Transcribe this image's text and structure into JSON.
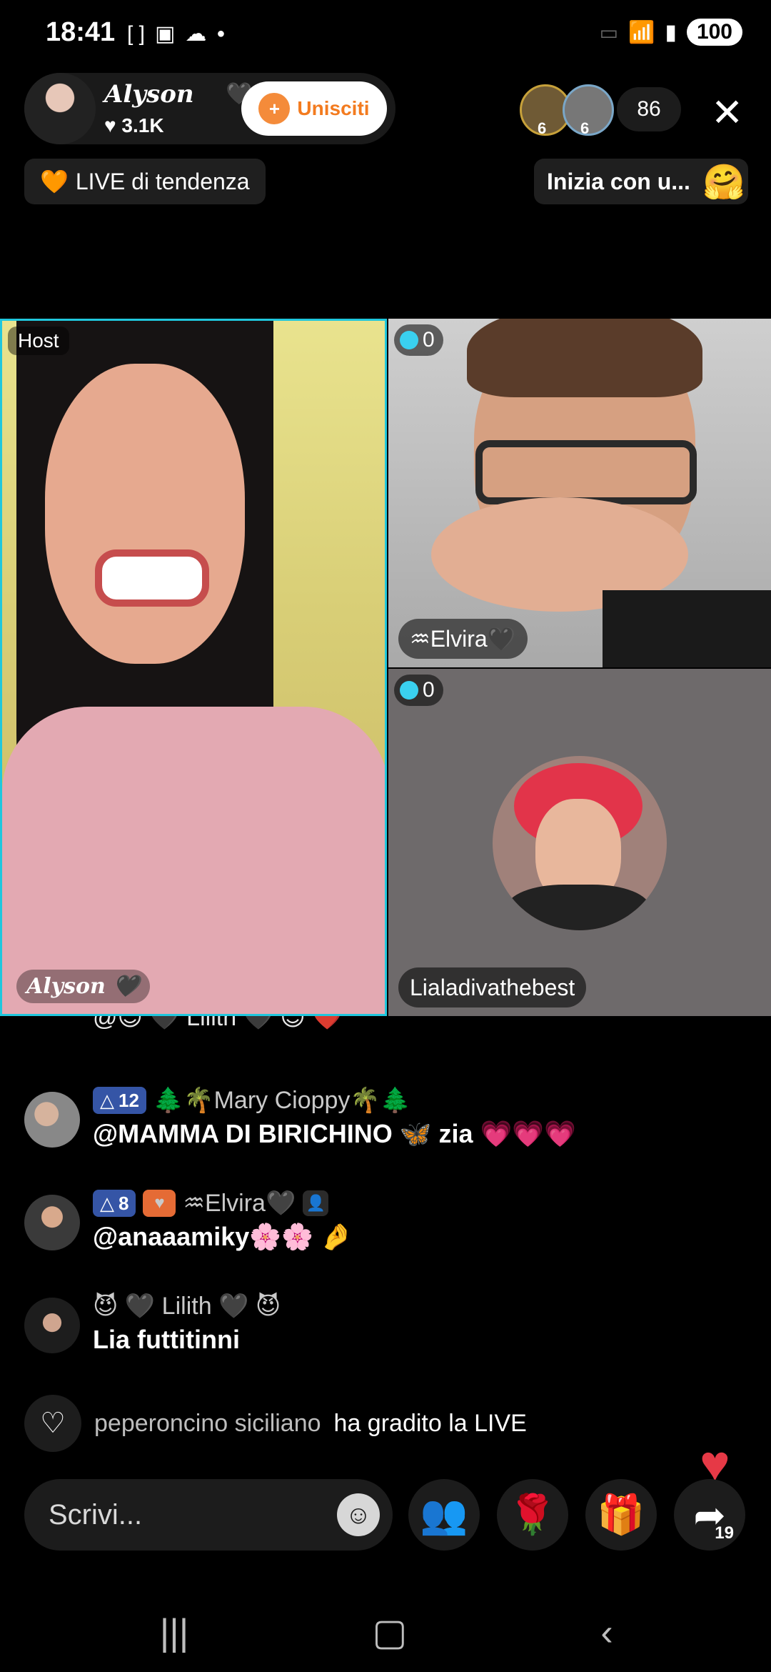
{
  "status_bar": {
    "time": "18:41",
    "battery": "100",
    "icons": [
      "bracket-icon",
      "screen-icon",
      "weather-icon",
      "dot-icon"
    ],
    "right_icons": [
      "cast-icon",
      "wifi-icon",
      "signal-icon"
    ]
  },
  "host": {
    "name": "Alyson",
    "likes": "3.1K",
    "join_label": "Unisciti"
  },
  "viewers": {
    "avatar_badges": [
      "6",
      "6"
    ],
    "count": "86"
  },
  "trend_label": "LIVE di tendenza",
  "inizia_label": "Inizia con u...",
  "videos": {
    "host_tag": "Host",
    "host_signature": "Alyson",
    "elvira": {
      "coins": "0",
      "name": "♒Elvira🖤"
    },
    "liala": {
      "coins": "0",
      "name": "Lialadivathebest"
    }
  },
  "chat": {
    "partial": "@😈 🖤 Lilith 🖤 😈 ❤️",
    "messages": [
      {
        "badge": "12",
        "user": "🌲🌴Mary Cioppy🌴🌲",
        "text": "@MAMMA DI BIRICHINO 🦋 zia 💗💗💗"
      },
      {
        "badge": "8",
        "user": "♒Elvira🖤",
        "text": "@anaaamiky🌸🌸 🤌"
      },
      {
        "badge": "",
        "user": "😈 🖤 Lilith 🖤 😈",
        "text": "Lia futtitinni"
      }
    ],
    "liked_user": "peperoncino siciliano",
    "liked_text": "ha gradito la LIVE"
  },
  "bottom": {
    "input_placeholder": "Scrivi...",
    "share_count": "19"
  },
  "colors": {
    "accent_cyan": "#20c7dd",
    "join_orange": "#f37b1f",
    "badge_blue": "#3555a6",
    "heart_red": "#e63946"
  }
}
